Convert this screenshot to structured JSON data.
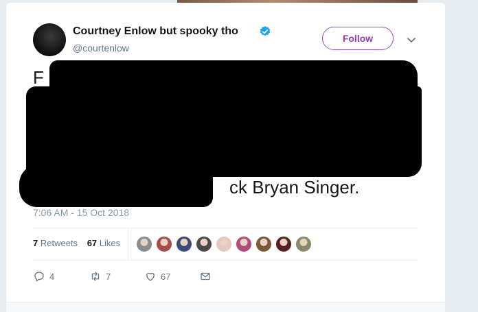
{
  "tweet": {
    "author_name": "Courtney Enlow but spooky tho",
    "handle": "@courtenlow",
    "follow_label": "Follow",
    "text_visible_start": "F",
    "text_visible_end": "ck Bryan Singer.",
    "timestamp": "7:06 AM - 15 Oct 2018",
    "retweets_count": "7",
    "retweets_label": "Retweets",
    "likes_count": "67",
    "likes_label": "Likes",
    "reply_count": "4",
    "retweet_count": "7",
    "like_count": "67"
  },
  "colors": {
    "accent": "#9d4fc4",
    "verified": "#1da1f2",
    "text_primary": "#14171a",
    "text_secondary": "#657786"
  },
  "likers": [
    {
      "name": "liker-avatar-1",
      "color": "#8c8c8c"
    },
    {
      "name": "liker-avatar-2",
      "color": "#a94b4b"
    },
    {
      "name": "liker-avatar-3",
      "color": "#3a4a7a"
    },
    {
      "name": "liker-avatar-4",
      "color": "#4a4a4a"
    },
    {
      "name": "liker-avatar-5",
      "color": "#e8c7c0"
    },
    {
      "name": "liker-avatar-6",
      "color": "#b24a7a"
    },
    {
      "name": "liker-avatar-7",
      "color": "#7a5a3a"
    },
    {
      "name": "liker-avatar-8",
      "color": "#5a2020"
    },
    {
      "name": "liker-avatar-9",
      "color": "#8a8a6a"
    }
  ]
}
